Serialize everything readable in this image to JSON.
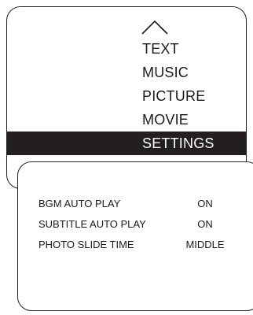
{
  "menu": {
    "scroll_up_icon": "chevron-up-icon",
    "items": [
      {
        "label": "TEXT",
        "selected": false
      },
      {
        "label": "MUSIC",
        "selected": false
      },
      {
        "label": "PICTURE",
        "selected": false
      },
      {
        "label": "MOVIE",
        "selected": false
      },
      {
        "label": "SETTINGS",
        "selected": true
      }
    ]
  },
  "settings": {
    "rows": [
      {
        "label": "BGM AUTO PLAY",
        "value": "ON"
      },
      {
        "label": "SUBTITLE AUTO PLAY",
        "value": "ON"
      },
      {
        "label": "PHOTO SLIDE TIME",
        "value": "MIDDLE"
      }
    ]
  },
  "colors": {
    "highlight_bg": "#231f20",
    "highlight_text": "#ffffff",
    "border": "#222222"
  }
}
